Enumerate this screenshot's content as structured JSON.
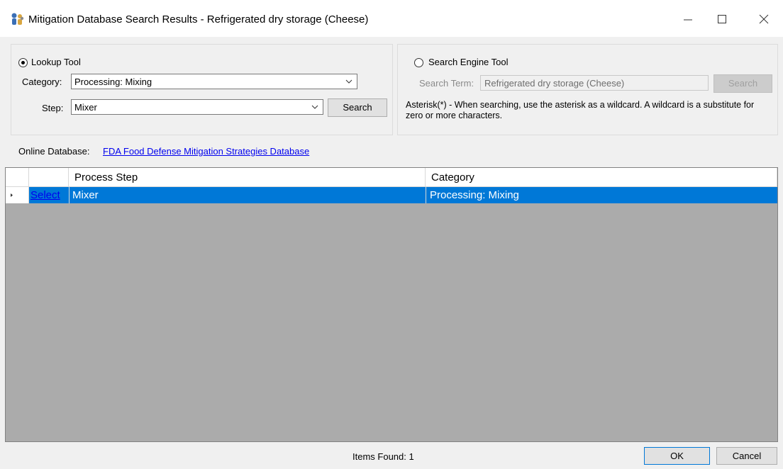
{
  "window": {
    "title": "Mitigation Database Search Results - Refrigerated dry storage (Cheese)",
    "controls": {
      "minimize": "—",
      "maximize": "☐",
      "close": "✕"
    }
  },
  "lookup_tool": {
    "label": "Lookup Tool",
    "selected": true,
    "category_label": "Category:",
    "category_value": "Processing: Mixing",
    "step_label": "Step:",
    "step_value": "Mixer",
    "search_button": "Search"
  },
  "search_engine_tool": {
    "label": "Search Engine Tool",
    "selected": false,
    "search_term_label": "Search Term:",
    "search_term_value": "Refrigerated dry storage (Cheese)",
    "search_button": "Search",
    "hint": "Asterisk(*) - When searching, use the asterisk as a wildcard.  A wildcard is a substitute for zero or more characters."
  },
  "online_database": {
    "label": "Online Database:",
    "link_text": "FDA Food Defense Mitigation Strategies Database"
  },
  "grid": {
    "columns": [
      "Process Step",
      "Category"
    ],
    "rows": [
      {
        "action": "Select",
        "process_step": "Mixer",
        "category": "Processing: Mixing",
        "selected": true
      }
    ]
  },
  "status": {
    "items_found": "Items Found:  1"
  },
  "buttons": {
    "ok": "OK",
    "cancel": "Cancel"
  },
  "colors": {
    "selection": "#0078d7",
    "grid_bg": "#ababab",
    "link": "#0000ee"
  }
}
